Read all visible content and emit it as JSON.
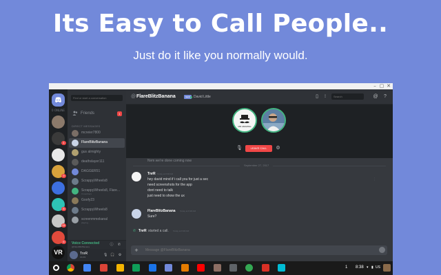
{
  "hero": {
    "title": "Its Easy to Call People..",
    "subtitle": "Just  do it like you normally would."
  },
  "window_controls": [
    "–",
    "▢",
    "✕"
  ],
  "guilds": {
    "online_label": "0 ONLINE",
    "badges": [
      "1",
      "9",
      "8",
      "11",
      "6",
      "5",
      "1",
      "NEW"
    ]
  },
  "sidebar": {
    "search_placeholder": "Find or start a conversation",
    "friends_label": "Friends",
    "friends_badge": "1",
    "dm_header": "DIRECT MESSAGES",
    "dms": [
      {
        "name": "mcreier7800",
        "sub": ""
      },
      {
        "name": "FlareBlitzBanana",
        "sub": ""
      },
      {
        "name": "gus almighty",
        "sub": ""
      },
      {
        "name": "deathslayer111",
        "sub": ""
      },
      {
        "name": "DAGGER51",
        "sub": ""
      },
      {
        "name": "ScrappyWheels8",
        "sub": ""
      },
      {
        "name": "ScrappyWheels8, Flare...",
        "sub": "3 members"
      },
      {
        "name": "Goofy23",
        "sub": ""
      },
      {
        "name": "ScrappyWheels8",
        "sub": ""
      },
      {
        "name": "screenmmekanal",
        "sub": "playing..."
      }
    ],
    "voice": {
      "status": "Voice Connected",
      "sub": "@FlareBlitzBanana"
    },
    "user": {
      "name": "TnrR",
      "tag": "#4409"
    }
  },
  "chat": {
    "at": "@",
    "channel_name": "FlareBlitzBanana",
    "tag": "NEW",
    "nickname": "David Little",
    "search_placeholder": "Search",
    "call": {
      "avatar_label": "MR AMAZING",
      "leave_label": "LEAVE CALL"
    },
    "messages": {
      "top_line": "Nvm we're done coming now",
      "date_divider": "September 27, 2017",
      "group1": {
        "author": "TnrR",
        "time": "Today at 8:38 AM",
        "lines": [
          "hey david mind if i call you for just a sec",
          "need screenshots for the app",
          "dont need to talk",
          "just need to show the ux"
        ]
      },
      "group2": {
        "author": "FlareBlitzBanana",
        "time": "Today at 8:38 AM",
        "lines": [
          "Sure?"
        ]
      },
      "call_event": {
        "author": "TnrR",
        "text": "started a call.",
        "time": "Today at 8:38 AM"
      }
    },
    "composer_placeholder": "Message @FlareBlitzBanana"
  },
  "taskbar": {
    "notification_count": "1",
    "time": "8:38",
    "locale": "US"
  },
  "colors": {
    "background": "#7289da",
    "discord_dark": "#36393e",
    "leave_red": "#f04747",
    "voice_green": "#43b581"
  }
}
